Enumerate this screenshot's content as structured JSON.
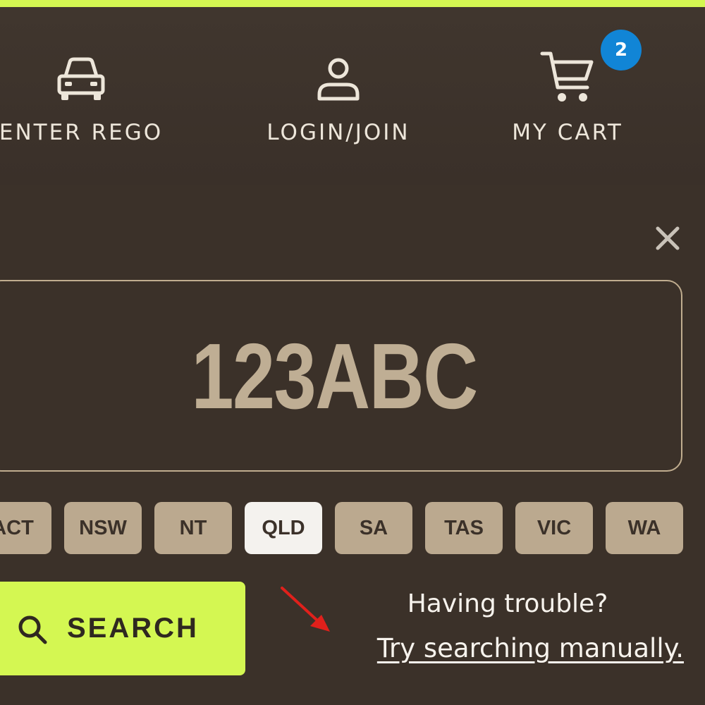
{
  "nav": {
    "rego_label": "ENTER REGO",
    "login_label": "LOGIN/JOIN",
    "cart_label": "MY CART",
    "cart_count": "2"
  },
  "plate": {
    "placeholder": "123ABC"
  },
  "states": [
    "ACT",
    "NSW",
    "NT",
    "QLD",
    "SA",
    "TAS",
    "VIC",
    "WA"
  ],
  "selected_state": "QLD",
  "search": {
    "label": "SEARCH"
  },
  "help": {
    "prompt": "Having trouble?",
    "link": "Try searching manually."
  },
  "colors": {
    "background": "#3b3129",
    "accent": "#d4f752",
    "state_button": "#bba98f",
    "state_selected": "#f4f2ee",
    "badge": "#1185d6",
    "annotation_arrow": "#e0201b"
  },
  "icons": {
    "rego": "car-icon",
    "login": "user-icon",
    "cart": "cart-icon",
    "close": "close-icon",
    "search": "search-icon"
  }
}
